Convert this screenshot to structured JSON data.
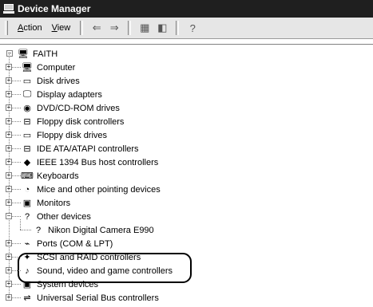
{
  "window": {
    "title": "Device Manager"
  },
  "menu": {
    "action": "Action",
    "action_accel": "A",
    "view": "View",
    "view_accel": "V"
  },
  "toolbar": {
    "back_glyph": "⇐",
    "forward_glyph": "⇒",
    "tree_glyph": "▦",
    "props_glyph": "◧",
    "help_glyph": "?"
  },
  "tree": {
    "root": {
      "label": "FAITH",
      "icon": "computer-icon"
    },
    "items": [
      {
        "label": "Computer",
        "icon": "computer-icon",
        "glyph": "🖥"
      },
      {
        "label": "Disk drives",
        "icon": "disk-drive-icon",
        "glyph": "▭"
      },
      {
        "label": "Display adapters",
        "icon": "display-adapter-icon",
        "glyph": "🖵"
      },
      {
        "label": "DVD/CD-ROM drives",
        "icon": "cdrom-icon",
        "glyph": "◉"
      },
      {
        "label": "Floppy disk controllers",
        "icon": "floppy-controller-icon",
        "glyph": "⊟"
      },
      {
        "label": "Floppy disk drives",
        "icon": "floppy-drive-icon",
        "glyph": "▭"
      },
      {
        "label": "IDE ATA/ATAPI controllers",
        "icon": "ide-controller-icon",
        "glyph": "⊟"
      },
      {
        "label": "IEEE 1394 Bus host controllers",
        "icon": "ieee1394-icon",
        "glyph": "◆"
      },
      {
        "label": "Keyboards",
        "icon": "keyboard-icon",
        "glyph": "⌨"
      },
      {
        "label": "Mice and other pointing devices",
        "icon": "mouse-icon",
        "glyph": "◔"
      },
      {
        "label": "Monitors",
        "icon": "monitor-icon",
        "glyph": "▣"
      },
      {
        "label": "Other devices",
        "icon": "unknown-device-icon",
        "glyph": "?"
      },
      {
        "label": "Nikon Digital Camera E990",
        "icon": "unknown-device-icon",
        "glyph": "?"
      },
      {
        "label": "Ports (COM & LPT)",
        "icon": "port-icon",
        "glyph": "⌁"
      },
      {
        "label": "SCSI and RAID controllers",
        "icon": "scsi-icon",
        "glyph": "✦"
      },
      {
        "label": "Sound, video and game controllers",
        "icon": "sound-icon",
        "glyph": "♪"
      },
      {
        "label": "System devices",
        "icon": "system-device-icon",
        "glyph": "▣"
      },
      {
        "label": "Universal Serial Bus controllers",
        "icon": "usb-icon",
        "glyph": "⇌"
      }
    ]
  }
}
